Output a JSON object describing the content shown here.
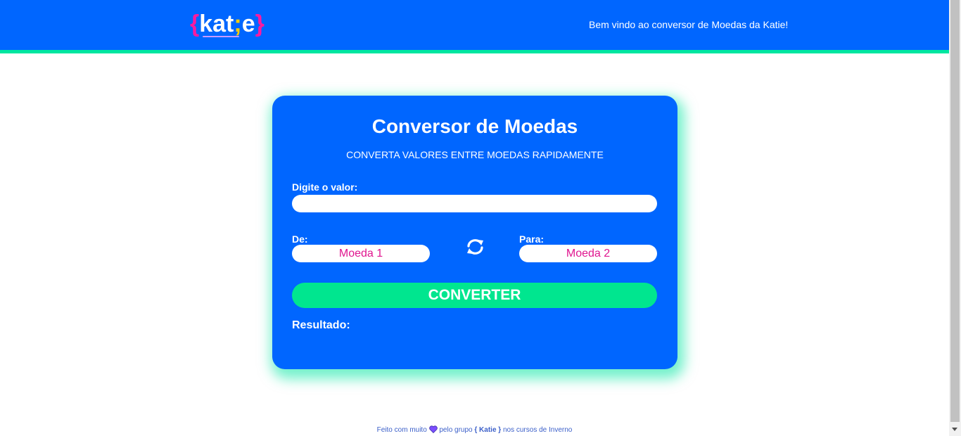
{
  "header": {
    "logo": {
      "open": "{",
      "text": "kat",
      "semi": ";",
      "end": "e",
      "close": "}"
    },
    "welcome": "Bem vindo ao conversor de Moedas da Katie!"
  },
  "card": {
    "title": "Conversor de Moedas",
    "subtitle": "CONVERTA VALORES ENTRE MOEDAS RAPIDAMENTE",
    "valor_label": "Digite o valor:",
    "valor_value": "",
    "de_label": "De:",
    "de_value": "Moeda 1",
    "para_label": "Para:",
    "para_value": "Moeda 2",
    "swap_icon": "refresh-icon",
    "convert_label": "CONVERTER",
    "result_label": "Resultado:"
  },
  "footer": {
    "prefix": "Feito com muito",
    "heart_icon": "heart-icon",
    "middle": "pelo grupo",
    "brand": "{ Katie }",
    "suffix": "nos cursos de Inverno"
  },
  "colors": {
    "primary": "#0066ff",
    "accent": "#00e68f",
    "pink": "#e0168f",
    "footer_text": "#3b5fc9"
  }
}
